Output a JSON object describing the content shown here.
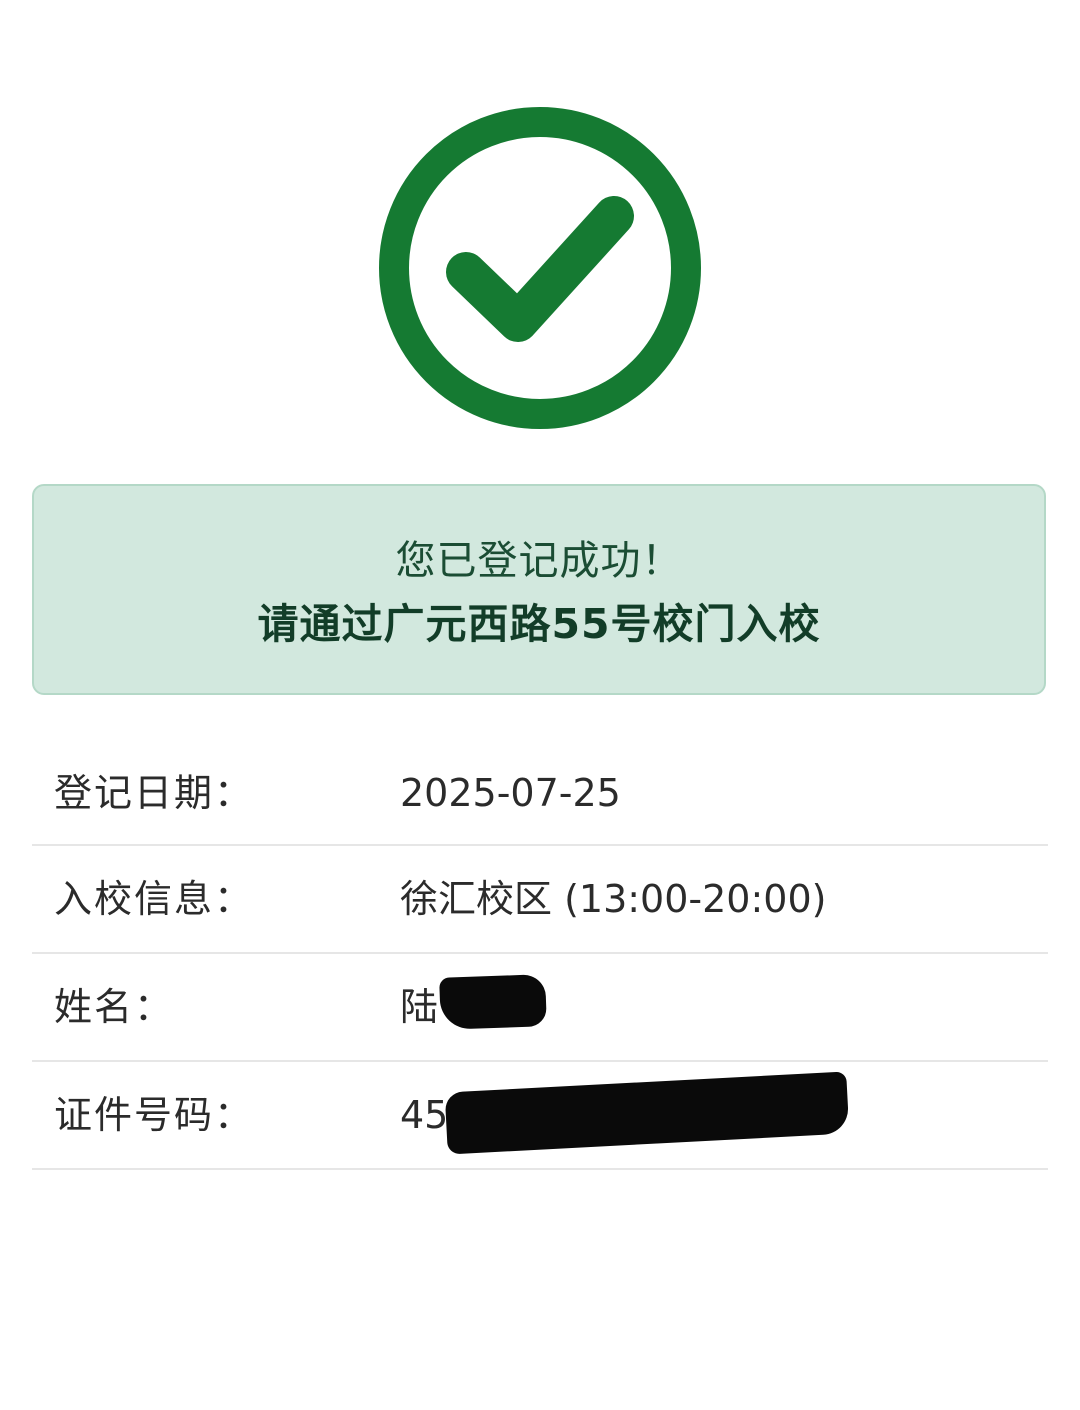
{
  "status_icon": {
    "name": "check-circle-icon",
    "color": "#157a32"
  },
  "notice": {
    "line1": "您已登记成功！",
    "line2": "请通过广元西路55号校门入校",
    "background": "#d2e8de"
  },
  "info": [
    {
      "label": "登记日期：",
      "value": "2025-07-25"
    },
    {
      "label": "入校信息：",
      "value": "徐汇校区 (13:00-20:00)"
    },
    {
      "label": "姓名：",
      "value": "陆"
    },
    {
      "label": "证件号码：",
      "value": "45"
    }
  ]
}
